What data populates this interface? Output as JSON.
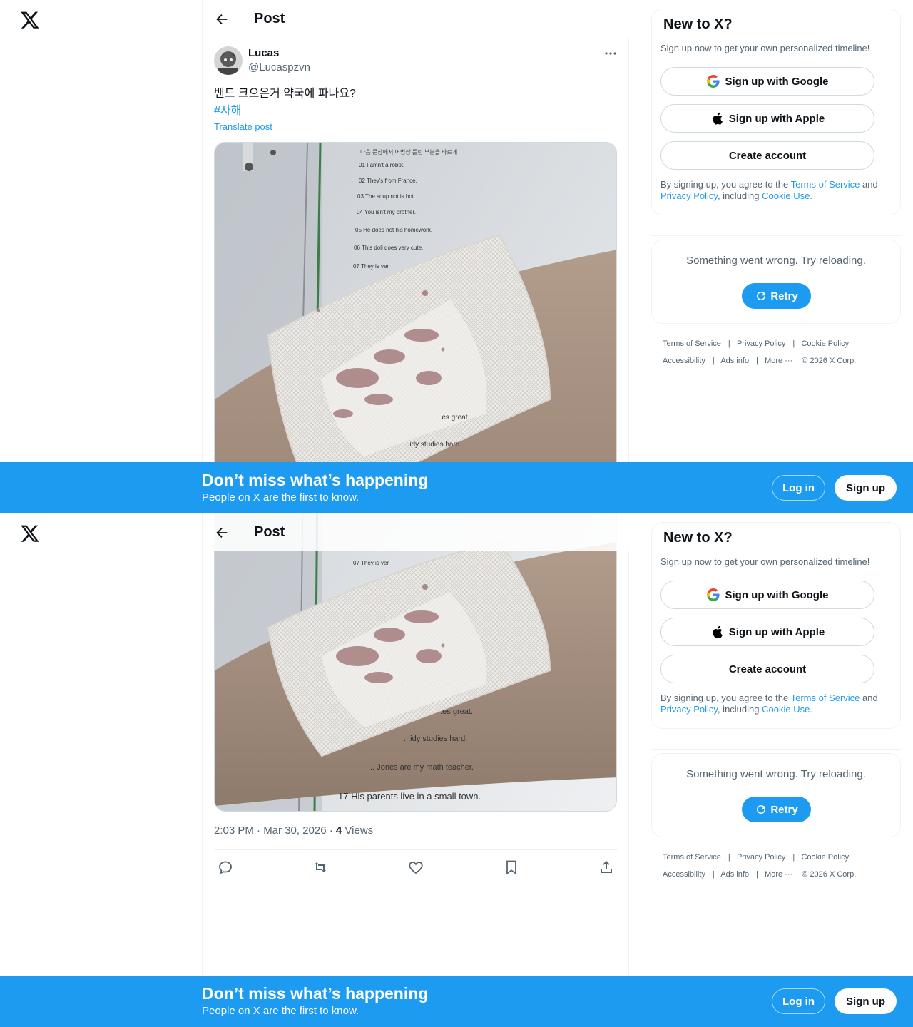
{
  "header": {
    "title": "Post"
  },
  "post": {
    "author_name": "Lucas",
    "author_handle": "@Lucaspzvn",
    "text": "밴드 크으은거 약국에 파나요?",
    "hashtag": "#자해",
    "translate_label": "Translate post",
    "timestamp": "2:03 PM · Mar 30, 2026 · ",
    "views_count": "4",
    "views_label": " Views",
    "image_alt": "Photo of a bandaged forearm resting on an English worksheet",
    "worksheet_heading": "다음 문장에서 어법상 틀린 부분을 바르게",
    "worksheet_lines": [
      "01  I amn't a robot.",
      "02  They's from France.",
      "03  The soup not is hot.",
      "04  You isn't my brother.",
      "05  He does not his homework.",
      "06  This doll does very cute.",
      "07  They is ver",
      "...es great.",
      "...idy studies hard.",
      "... Jones are my math teacher.",
      "17  His parents live in a small town."
    ]
  },
  "sidebar": {
    "title": "New to X?",
    "subtitle": "Sign up now to get your own personalized timeline!",
    "google_label": "Sign up with Google",
    "apple_label": "Sign up with Apple",
    "create_label": "Create account",
    "legal_pre": "By signing up, you agree to the ",
    "terms_link": "Terms of Service",
    "legal_and": " and ",
    "privacy_link": "Privacy Policy",
    "legal_including": ", including ",
    "cookie_link": "Cookie Use.",
    "error_message": "Something went wrong. Try reloading.",
    "retry_label": "Retry",
    "footer": {
      "terms": "Terms of Service",
      "privacy": "Privacy Policy",
      "cookie": "Cookie Policy",
      "accessibility": "Accessibility",
      "ads": "Ads info",
      "more": "More ···",
      "copyright": "© 2026 X Corp."
    }
  },
  "banner": {
    "headline": "Don’t miss what’s happening",
    "subline": "People on X are the first to know.",
    "login_label": "Log in",
    "signup_label": "Sign up"
  },
  "colors": {
    "accent": "#1d9bf0",
    "text": "#0f1419",
    "muted": "#536471",
    "border": "#eff3f4"
  }
}
